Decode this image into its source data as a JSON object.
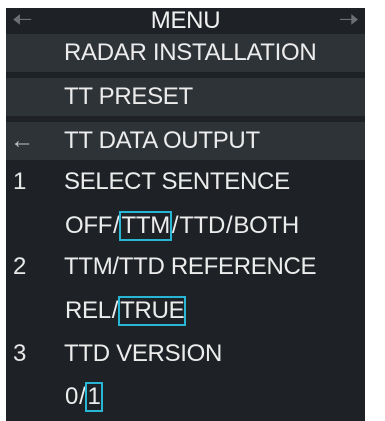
{
  "menu": {
    "title": "MENU",
    "nav_left_icon": "left-arrow-icon",
    "nav_right_icon": "right-arrow-icon",
    "back_icon": "back-arrow-icon",
    "back_glyph": "←",
    "items": [
      {
        "label": "RADAR INSTALLATION"
      },
      {
        "label": "TT PRESET"
      },
      {
        "label": "TT DATA OUTPUT"
      }
    ],
    "settings": [
      {
        "number": "1",
        "label": "SELECT SENTENCE",
        "options": [
          "OFF",
          "TTM",
          "TTD",
          "BOTH"
        ],
        "selected": "TTM"
      },
      {
        "number": "2",
        "label": "TTM/TTD REFERENCE",
        "options": [
          "REL",
          "TRUE"
        ],
        "selected": "TRUE"
      },
      {
        "number": "3",
        "label": "TTD VERSION",
        "options": [
          "0",
          "1"
        ],
        "selected": "1"
      }
    ],
    "separator": "/",
    "colors": {
      "panel_bg": "#1e2226",
      "band_bg": "#2e3338",
      "text": "#e8e8e8",
      "selected_outline": "#27b6d4",
      "nav_arrow": "#6c7074"
    }
  }
}
